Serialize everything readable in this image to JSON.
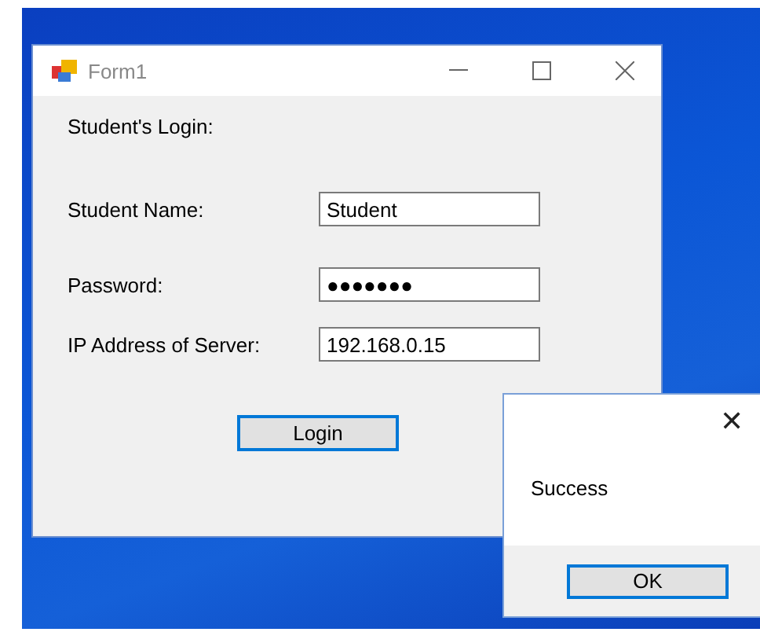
{
  "window": {
    "title": "Form1",
    "heading": "Student's Login:",
    "fields": [
      {
        "label": "Student Name:",
        "value": "Student"
      },
      {
        "label": "Password:",
        "value": "●●●●●●●"
      },
      {
        "label": "IP Address of Server:",
        "value": "192.168.0.15"
      }
    ],
    "button": "Login"
  },
  "message_box": {
    "close": "✕",
    "message": "Success",
    "button": "OK"
  }
}
